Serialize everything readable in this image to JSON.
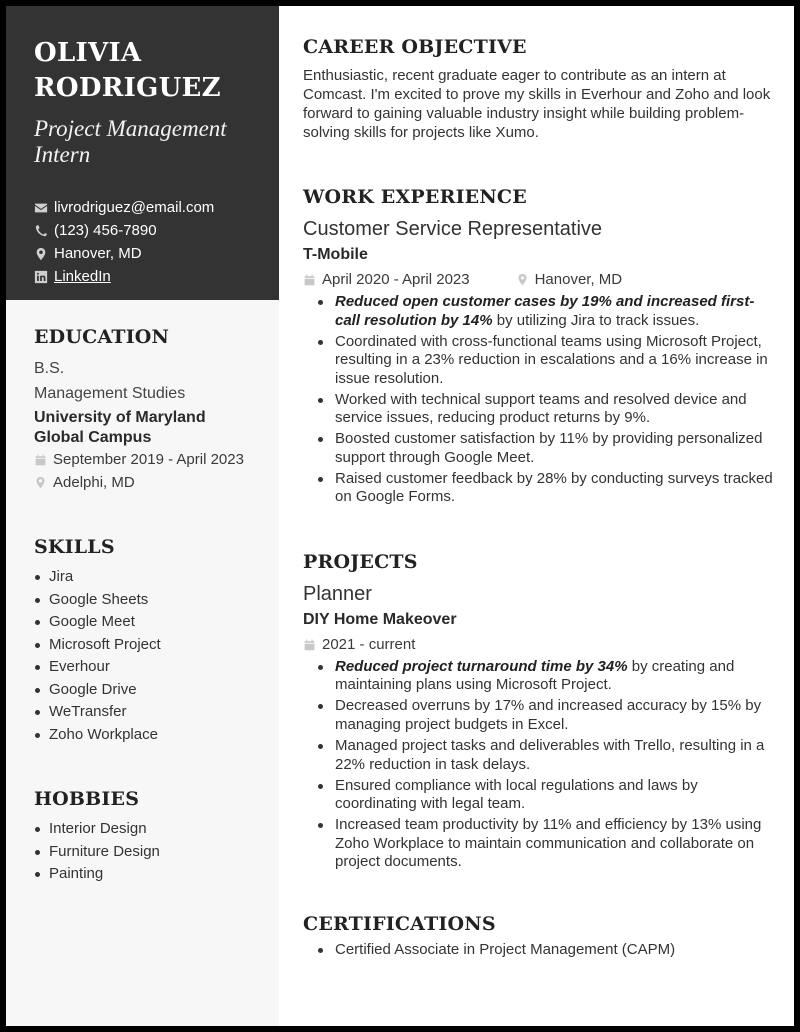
{
  "header": {
    "first_name": "OLIVIA",
    "last_name": "RODRIGUEZ",
    "title_line1": "Project Management",
    "title_line2": "Intern"
  },
  "contact": {
    "email": "livrodriguez@email.com",
    "phone": "(123) 456-7890",
    "location": "Hanover, MD",
    "linkedin": "LinkedIn",
    "icons": [
      "envelope-icon",
      "phone-icon",
      "map-pin-icon",
      "linkedin-icon"
    ]
  },
  "education": {
    "heading": "EDUCATION",
    "degree": "B.S.",
    "field": "Management Studies",
    "school": "University of Maryland Global Campus",
    "dates": "September 2019 - April 2023",
    "location": "Adelphi, MD"
  },
  "skills": {
    "heading": "SKILLS",
    "items": [
      "Jira",
      "Google Sheets",
      "Google Meet",
      "Microsoft Project",
      "Everhour",
      "Google Drive",
      "WeTransfer",
      "Zoho Workplace"
    ]
  },
  "hobbies": {
    "heading": "HOBBIES",
    "items": [
      "Interior Design",
      "Furniture Design",
      "Painting"
    ]
  },
  "objective": {
    "heading": "CAREER OBJECTIVE",
    "text": "Enthusiastic, recent graduate eager to contribute as an intern at Comcast. I'm excited to prove my skills in Everhour and Zoho and look forward to gaining valuable industry insight while building problem-solving skills for projects like Xumo."
  },
  "work": {
    "heading": "WORK EXPERIENCE",
    "jobs": [
      {
        "title": "Customer Service Representative",
        "company": "T-Mobile",
        "dates": "April 2020 - April 2023",
        "location": "Hanover, MD",
        "bullets": [
          {
            "bold": "Reduced open customer cases by 19% and increased first-call resolution by 14%",
            "text": " by utilizing Jira to track issues."
          },
          {
            "bold": "",
            "text": "Coordinated with cross-functional teams using Microsoft Project, resulting in a 23% reduction in escalations and a 16% increase in issue resolution."
          },
          {
            "bold": "",
            "text": "Worked with technical support teams and resolved device and service issues, reducing product returns by 9%."
          },
          {
            "bold": "",
            "text": "Boosted customer satisfaction by 11% by providing personalized support through Google Meet."
          },
          {
            "bold": "",
            "text": "Raised customer feedback by 28% by conducting surveys tracked on Google Forms."
          }
        ]
      }
    ]
  },
  "projects": {
    "heading": "PROJECTS",
    "items": [
      {
        "role": "Planner",
        "name": "DIY Home Makeover",
        "dates": "2021 - current",
        "bullets": [
          {
            "bold": "Reduced project turnaround time by 34%",
            "text": " by creating and maintaining plans using Microsoft Project."
          },
          {
            "bold": "",
            "text": "Decreased overruns by 17% and increased accuracy by 15% by managing project budgets in Excel."
          },
          {
            "bold": "",
            "text": "Managed project tasks and deliverables with Trello, resulting in a 22% reduction in task delays."
          },
          {
            "bold": "",
            "text": "Ensured compliance with local regulations and laws by coordinating with legal team."
          },
          {
            "bold": "",
            "text": "Increased team productivity by 11% and efficiency by 13% using Zoho Workplace to maintain communication and collaborate on project documents."
          }
        ]
      }
    ]
  },
  "certifications": {
    "heading": "CERTIFICATIONS",
    "items": [
      "Certified Associate in Project Management (CAPM)"
    ]
  },
  "colors": {
    "sidebar_header_bg": "#333333",
    "sidebar_bg": "#f7f7f7",
    "icon_gray": "#c8c8c8",
    "text": "#333333",
    "frame": "#000000"
  }
}
